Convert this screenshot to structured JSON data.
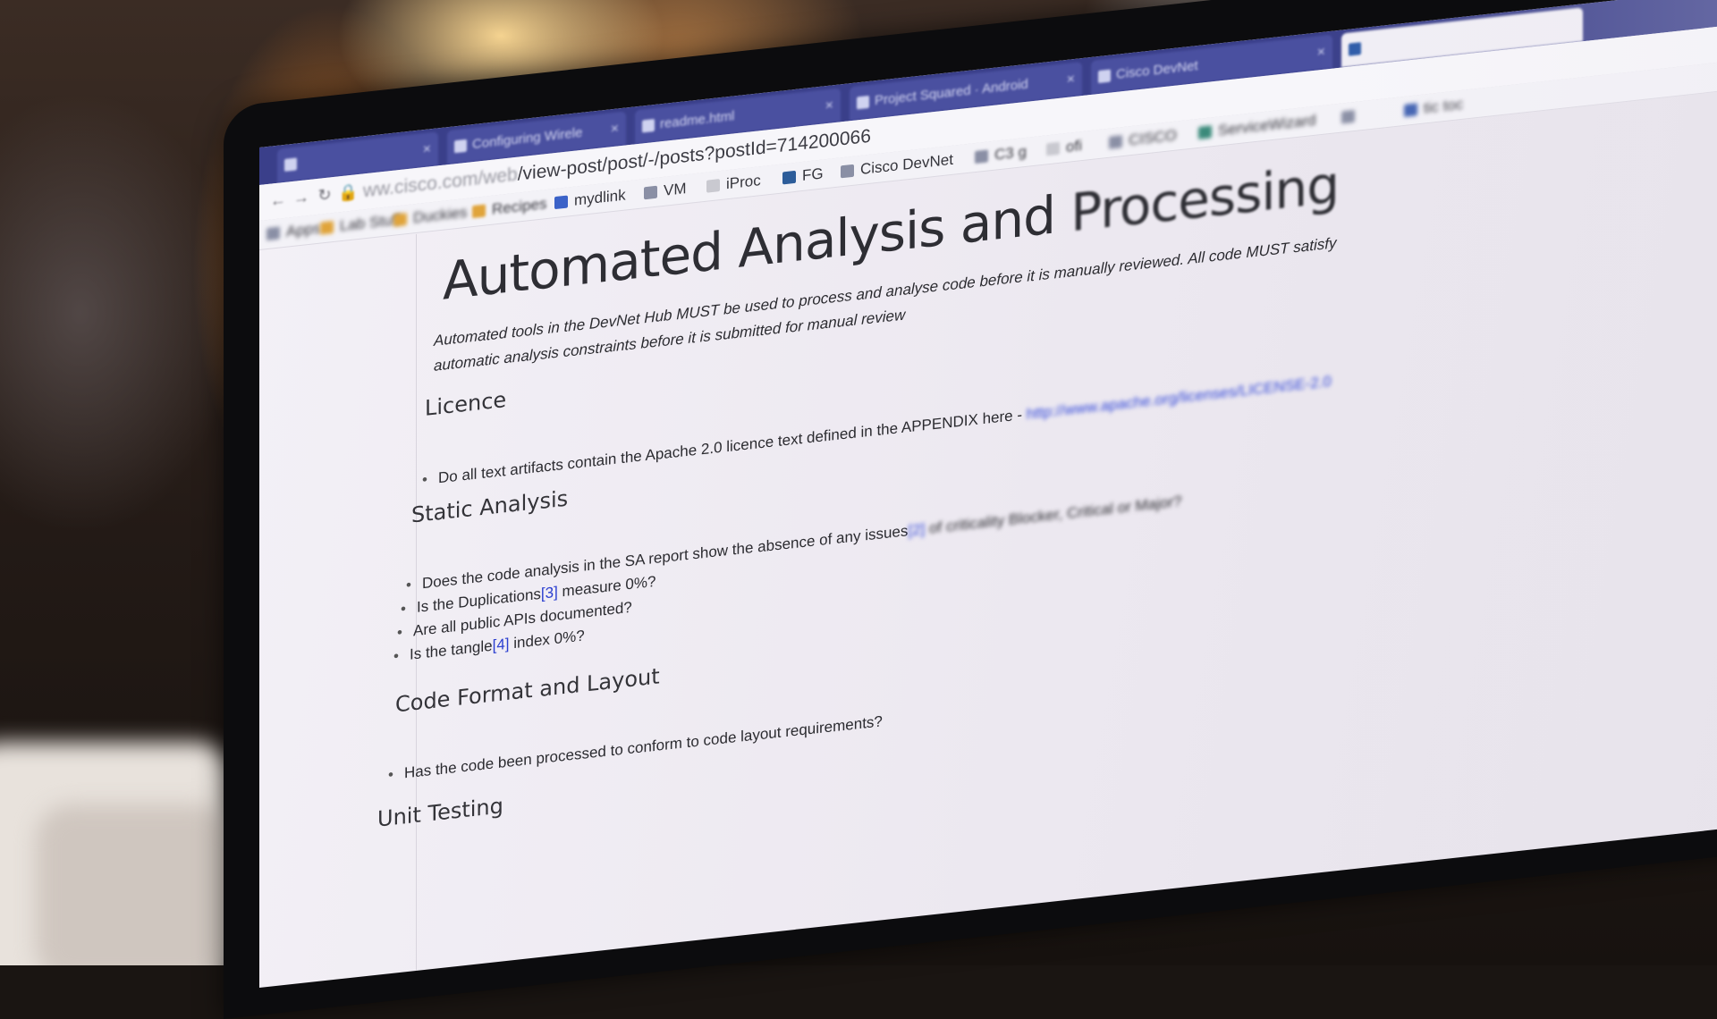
{
  "browser": {
    "tabs": [
      {
        "label": "",
        "active": false
      },
      {
        "label": "Configuring Wirele",
        "active": false
      },
      {
        "label": "readme.html",
        "active": false
      },
      {
        "label": "Project Squared · Android",
        "active": false
      },
      {
        "label": "Cisco DevNet",
        "active": false
      },
      {
        "label": "",
        "active": true
      }
    ],
    "address": {
      "scheme_host": "ww.cisco.com/web",
      "path": "/view-post/post/-/posts?postId=714200066"
    },
    "bookmarks": [
      {
        "label": "Apps",
        "icon": "apps-icon"
      },
      {
        "label": "Lab Stuff",
        "icon": "folder-icon"
      },
      {
        "label": "Duckies",
        "icon": "folder-icon"
      },
      {
        "label": "Recipes",
        "icon": "folder-icon"
      },
      {
        "label": "mydlink",
        "icon": "dlink-icon"
      },
      {
        "label": "VM",
        "icon": "grid-icon"
      },
      {
        "label": "iProc",
        "icon": "page-icon"
      },
      {
        "label": "FG",
        "icon": "fg-icon"
      },
      {
        "label": "Cisco DevNet",
        "icon": "grid-icon"
      },
      {
        "label": "C3 g",
        "icon": "grid-icon"
      },
      {
        "label": "ofi",
        "icon": "page-icon"
      },
      {
        "label": "CISCO",
        "icon": "grid-icon"
      },
      {
        "label": "ServiceWizard",
        "icon": "service-icon"
      },
      {
        "label": "",
        "icon": "grid-icon"
      },
      {
        "label": "tic toc",
        "icon": "chart-icon"
      }
    ]
  },
  "content": {
    "title_main": "Automated Analysis and ",
    "title_tail": "Processing",
    "intro_clear": "Automated tools in the DevNet Hub MUST be used to process and analyse code before it is manually reviewed. All code MUST satisfy",
    "intro_line2": "automatic analysis constraints before it is submitted for manual review",
    "sections": {
      "licence": {
        "heading": "Licence",
        "item_text": "Do all text artifacts contain the Apache 2.0 licence text defined in the APPENDIX here - ",
        "item_link": "http://www.apache.org/licenses/LICENSE-2.0"
      },
      "static_analysis": {
        "heading": "Static Analysis",
        "item1_text": "Does the code analysis in the SA report show the absence of any issues",
        "item1_ref": "[2]",
        "item1_tail": " of criticality Blocker, Critical or Major?",
        "item2_pre": "Is the Duplications",
        "item2_ref": "[3]",
        "item2_post": " measure 0%?",
        "item3": "Are all public APIs documented?",
        "item4_pre": "Is the tangle",
        "item4_ref": "[4]",
        "item4_post": " index 0%?"
      },
      "code_format": {
        "heading": "Code Format and Layout",
        "item1": "Has the code been processed to conform to code layout requirements?"
      },
      "unit_testing": {
        "heading": "Unit Testing"
      }
    }
  },
  "colors": {
    "tabstrip": "#3a3f8a",
    "link": "#2b3fd0",
    "page_bg": "#f3f0f6"
  }
}
